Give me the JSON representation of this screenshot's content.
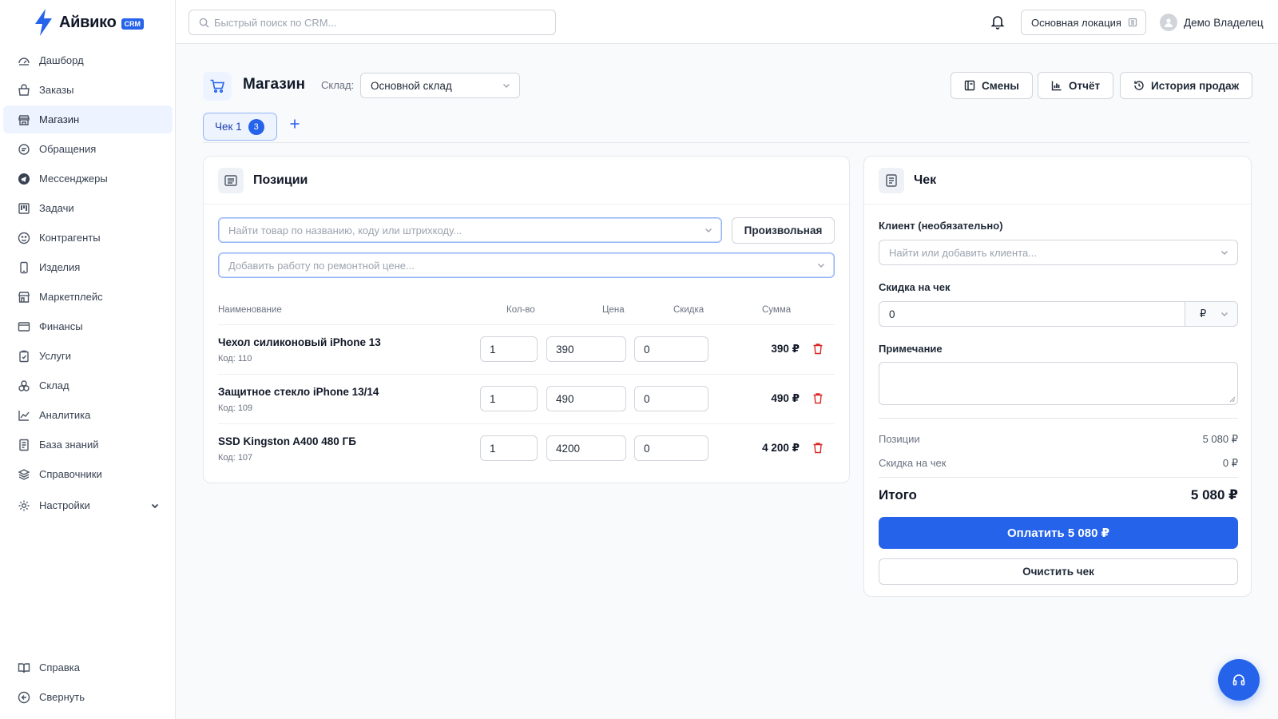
{
  "app": {
    "name": "Айвико",
    "badge": "CRM"
  },
  "search": {
    "placeholder": "Быстрый поиск по CRM..."
  },
  "topbar": {
    "location": "Основная локация",
    "user": "Демо Владелец"
  },
  "sidebar": {
    "items": [
      {
        "label": "Дашборд",
        "icon": "dashboard-icon"
      },
      {
        "label": "Заказы",
        "icon": "orders-icon"
      },
      {
        "label": "Магазин",
        "icon": "store-icon",
        "active": true
      },
      {
        "label": "Обращения",
        "icon": "chat-icon"
      },
      {
        "label": "Мессенджеры",
        "icon": "telegram-icon"
      },
      {
        "label": "Задачи",
        "icon": "kanban-icon"
      },
      {
        "label": "Контрагенты",
        "icon": "smile-icon"
      },
      {
        "label": "Изделия",
        "icon": "phone-icon"
      },
      {
        "label": "Маркетплейс",
        "icon": "marketplace-icon"
      },
      {
        "label": "Финансы",
        "icon": "wallet-icon"
      },
      {
        "label": "Услуги",
        "icon": "clipboard-icon"
      },
      {
        "label": "Склад",
        "icon": "boxes-icon"
      },
      {
        "label": "Аналитика",
        "icon": "chart-line-icon"
      },
      {
        "label": "База знаний",
        "icon": "document-icon"
      },
      {
        "label": "Справочники",
        "icon": "layers-icon"
      },
      {
        "label": "Настройки",
        "icon": "gear-icon"
      }
    ],
    "bottom": [
      {
        "label": "Справка",
        "icon": "book-icon"
      },
      {
        "label": "Свернуть",
        "icon": "collapse-icon"
      }
    ]
  },
  "page": {
    "title": "Магазин",
    "warehouse_label": "Склад:",
    "warehouse_value": "Основной склад",
    "buttons": {
      "shifts": "Смены",
      "report": "Отчёт",
      "history": "История продаж"
    }
  },
  "tabs": [
    {
      "label": "Чек 1",
      "count": "3"
    }
  ],
  "positions": {
    "title": "Позиции",
    "product_search_placeholder": "Найти товар по названию, коду или штрихкоду...",
    "custom_button": "Произвольная",
    "work_search_placeholder": "Добавить работу по ремонтной цене...",
    "columns": {
      "name": "Наименование",
      "qty": "Кол-во",
      "price": "Цена",
      "discount": "Скидка",
      "sum": "Сумма"
    },
    "rows": [
      {
        "name": "Чехол силиконовый iPhone 13",
        "code": "Код: 110",
        "qty": "1",
        "price": "390",
        "discount": "0",
        "sum": "390 ₽"
      },
      {
        "name": "Защитное стекло iPhone 13/14",
        "code": "Код: 109",
        "qty": "1",
        "price": "490",
        "discount": "0",
        "sum": "490 ₽"
      },
      {
        "name": "SSD Kingston A400 480 ГБ",
        "code": "Код: 107",
        "qty": "1",
        "price": "4200",
        "discount": "0",
        "sum": "4 200 ₽"
      }
    ]
  },
  "receipt": {
    "title": "Чек",
    "client_label": "Клиент (необязательно)",
    "client_placeholder": "Найти или добавить клиента...",
    "discount_label": "Скидка на чек",
    "discount_value": "0",
    "currency": "₽",
    "note_label": "Примечание",
    "positions_label": "Позиции",
    "positions_value": "5 080 ₽",
    "discount_sum_label": "Скидка на чек",
    "discount_sum_value": "0 ₽",
    "total_label": "Итого",
    "total_value": "5 080 ₽",
    "pay_button": "Оплатить 5 080 ₽",
    "clear_button": "Очистить чек"
  },
  "colors": {
    "accent": "#2563eb",
    "danger": "#dc2626",
    "active_bg": "#eef4ff"
  }
}
